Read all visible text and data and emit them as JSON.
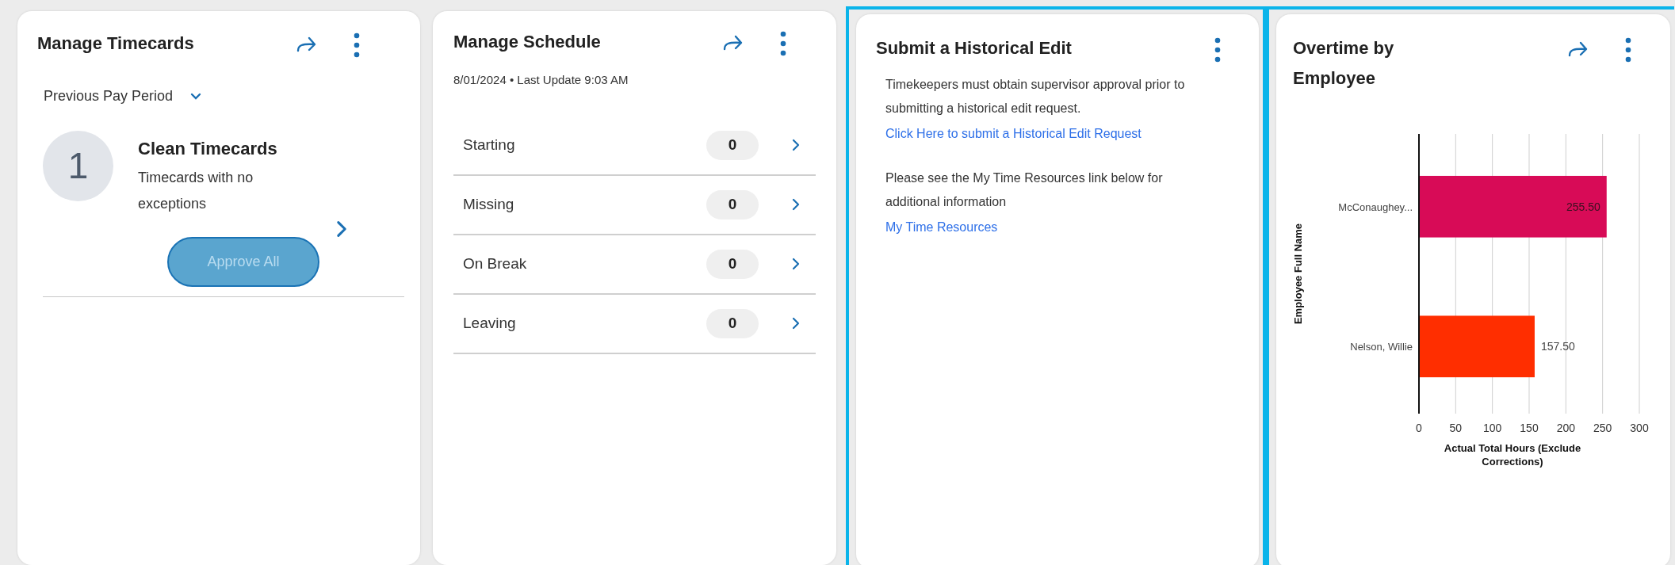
{
  "cards": [
    {
      "kind": "timecards",
      "title": "Manage Timecards",
      "share": true,
      "highlighted": false,
      "period": "Previous Pay Period",
      "count": "1",
      "heading": "Clean Timecards",
      "description": "Timecards with no exceptions",
      "button": {
        "label": "Approve All",
        "disabled": true
      }
    },
    {
      "kind": "schedule",
      "title": "Manage Schedule",
      "share": true,
      "highlighted": false,
      "subtitle": "8/01/2024 • Last Update 9:03 AM",
      "rows": [
        {
          "label": "Starting",
          "count": "0"
        },
        {
          "label": "Missing",
          "count": "0"
        },
        {
          "label": "On Break",
          "count": "0"
        },
        {
          "label": "Leaving",
          "count": "0"
        }
      ]
    },
    {
      "kind": "text",
      "title": "Submit a Historical Edit",
      "share": false,
      "highlighted": true,
      "blocks": [
        {
          "text": "Timekeepers must obtain supervisor approval prior to submitting a historical edit request.",
          "link": "Click Here to submit a Historical Edit Request"
        },
        {
          "text": "Please see the My Time Resources link below for additional information",
          "link": "My Time Resources"
        }
      ]
    },
    {
      "kind": "chart",
      "title": "Overtime by Employee",
      "share": true,
      "highlighted": true,
      "chart_data": {
        "type": "bar",
        "orientation": "horizontal",
        "xlabel": "Actual Total Hours (Exclude Corrections)",
        "ylabel": "Employee Full Name",
        "categories": [
          "McConaughey...",
          "Nelson, Willie"
        ],
        "series": [
          {
            "color": "#d80b57",
            "values": [
              255.5,
              null
            ]
          },
          {
            "color": "#ff2e00",
            "values": [
              null,
              157.5
            ]
          }
        ],
        "stacked": true,
        "grid": true,
        "xlim": [
          0,
          300
        ],
        "xticks": [
          0,
          50,
          100,
          150,
          200,
          250,
          300
        ],
        "value_labels": [
          "255.50",
          "157.50"
        ]
      }
    }
  ]
}
